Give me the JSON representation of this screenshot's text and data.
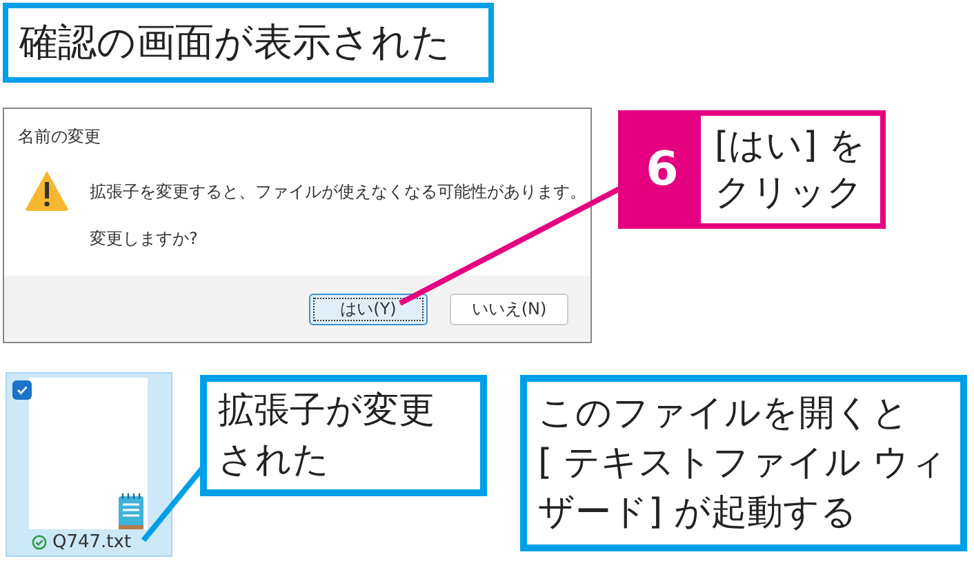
{
  "heading": "確認の画面が表示された",
  "dialog": {
    "title": "名前の変更",
    "message": "拡張子を変更すると、ファイルが使えなくなる可能性があります。",
    "question": "変更しますか?",
    "buttons": [
      {
        "label": "はい(Y)",
        "selected": true
      },
      {
        "label": "いいえ(N)",
        "selected": false
      }
    ]
  },
  "step": {
    "number": "6",
    "lines": [
      "[はい] を",
      "クリック"
    ]
  },
  "file": {
    "name": "Q747.txt",
    "checked": true
  },
  "notes": [
    {
      "lines": [
        "拡張子が変更",
        "された"
      ]
    },
    {
      "lines": [
        "このファイルを開くと",
        "[ テキストファイル ウィ",
        "ザード] が起動する"
      ]
    }
  ]
}
